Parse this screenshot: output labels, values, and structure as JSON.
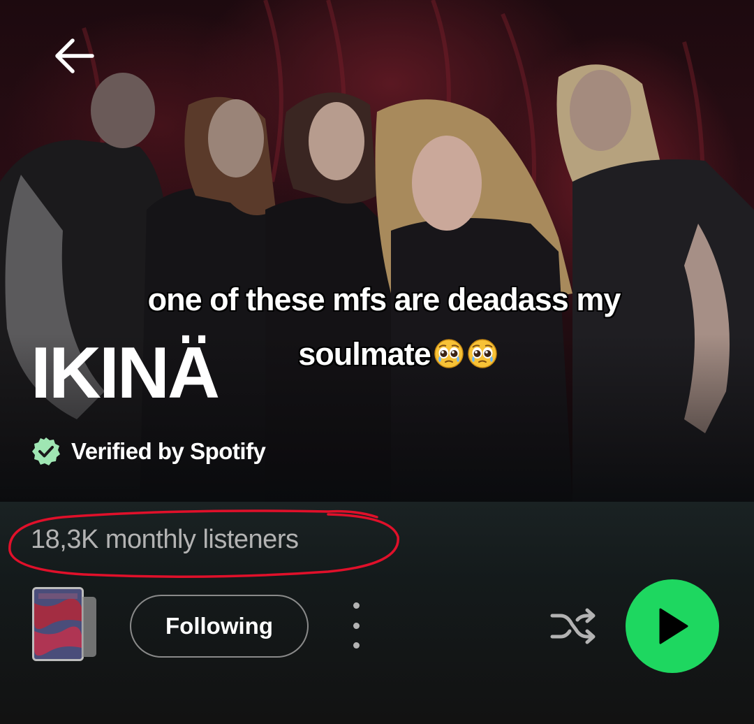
{
  "header": {
    "back_icon": "arrow-left-icon"
  },
  "hero": {
    "caption_line1": "one of these mfs are deadass my",
    "caption_line2": "soulmate",
    "caption_emojis": [
      "pleading-face-emoji",
      "pleading-face-emoji"
    ],
    "artist_name": "IKINÄ",
    "verified_label": "Verified by Spotify",
    "verified_icon": "verified-badge-icon"
  },
  "stats": {
    "monthly_listeners": "18,3K monthly listeners"
  },
  "actions": {
    "follow_label": "Following",
    "more_icon": "more-vertical-icon",
    "shuffle_icon": "shuffle-icon",
    "play_icon": "play-icon"
  },
  "colors": {
    "accent_green": "#1ed760",
    "annotation_red": "#e0102a",
    "secondary_text": "#b3b3b3",
    "background": "#121212"
  }
}
